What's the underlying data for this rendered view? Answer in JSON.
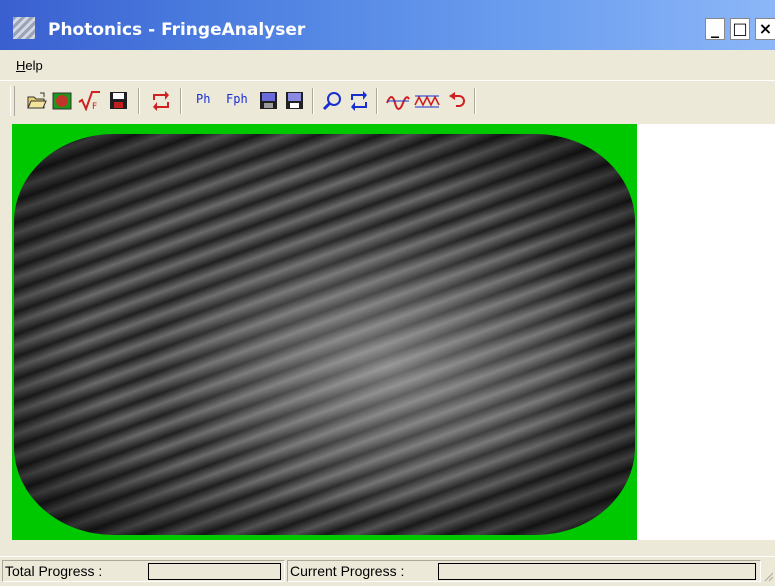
{
  "window": {
    "title": "Photonics - FringeAnalyser",
    "controls": {
      "minimize": "_",
      "maximize": "□",
      "close": "×"
    }
  },
  "menu": {
    "help_label": "Help",
    "help_accel": "H",
    "help_rest": "elp"
  },
  "toolbar": {
    "buttons": [
      {
        "icon": "open-folder-icon"
      },
      {
        "icon": "mask-icon",
        "color": "#c0342a"
      },
      {
        "icon": "sqrt-f-icon",
        "text": "√F"
      },
      {
        "icon": "save-icon"
      },
      {
        "icon": "refresh-icon"
      },
      {
        "icon": "phase-icon",
        "text": "Ph"
      },
      {
        "icon": "filtered-phase-icon",
        "text": "Fph"
      },
      {
        "icon": "save-image-icon"
      },
      {
        "icon": "save-image-2-icon"
      },
      {
        "icon": "zoom-icon"
      },
      {
        "icon": "refresh-2-icon"
      },
      {
        "icon": "wave-icon"
      },
      {
        "icon": "sawtooth-icon"
      },
      {
        "icon": "undo-icon"
      }
    ]
  },
  "viewport": {
    "mask_color": "#00c800"
  },
  "status": {
    "total_label": "Total Progress :",
    "current_label": "Current Progress :",
    "total_value": 0,
    "current_value": 0
  }
}
